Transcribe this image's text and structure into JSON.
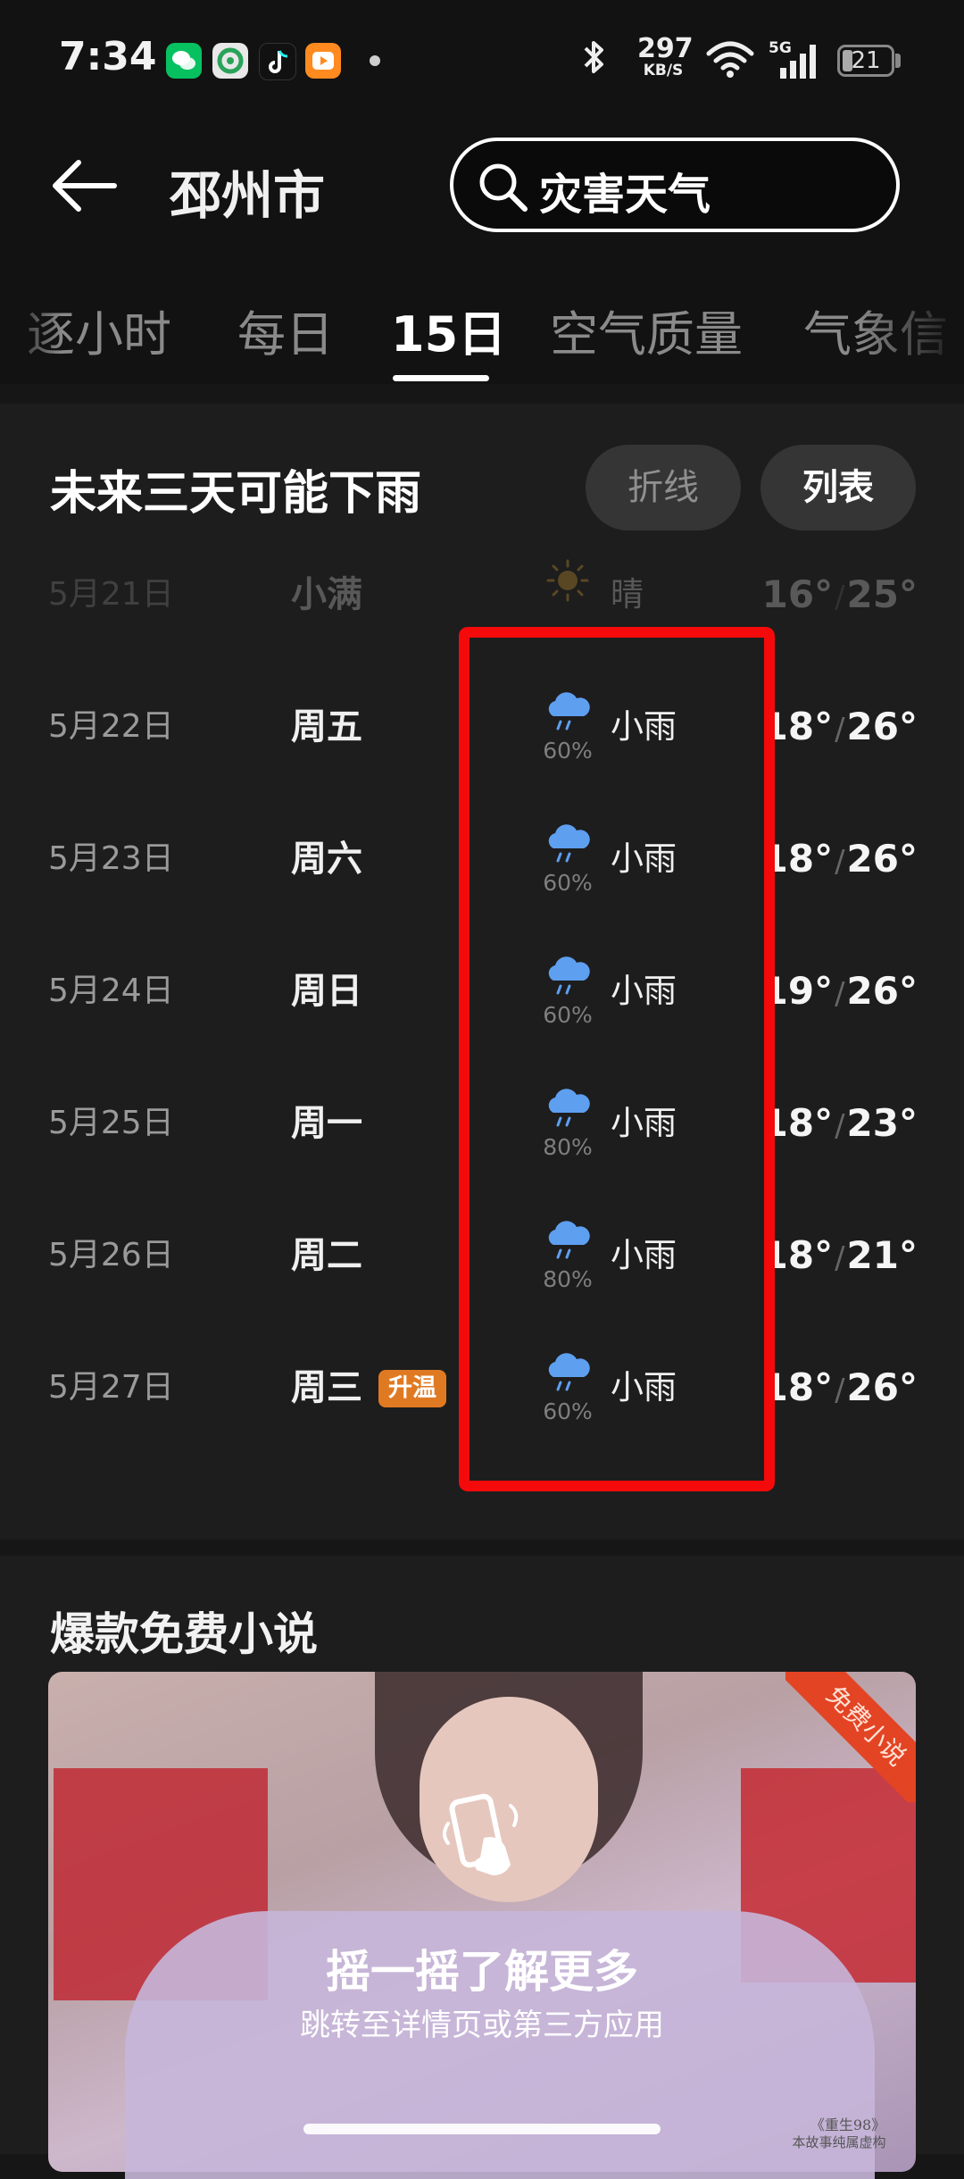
{
  "status_bar": {
    "time": "7:34",
    "network_speed": "297",
    "network_unit": "KB/S",
    "signal_label": "5G",
    "battery": "21",
    "app_icons": [
      "wechat-icon",
      "browser-icon",
      "tiktok-icon",
      "video-app-icon"
    ]
  },
  "header": {
    "city": "邳州市",
    "search_text": "灾害天气"
  },
  "tabs": [
    {
      "label": "逐小时",
      "active": false
    },
    {
      "label": "每日",
      "active": false
    },
    {
      "label": "15日",
      "active": true
    },
    {
      "label": "空气质量",
      "active": false
    },
    {
      "label": "气象信",
      "active": false
    }
  ],
  "forecast": {
    "title": "未来三天可能下雨",
    "view_line": "折线",
    "view_list": "列表",
    "rows": [
      {
        "date": "5月21日",
        "weekday": "小满",
        "condition": "晴",
        "pop": "",
        "low": "16°",
        "high": "25°",
        "icon": "sun-icon",
        "badge": ""
      },
      {
        "date": "5月22日",
        "weekday": "周五",
        "condition": "小雨",
        "pop": "60%",
        "low": "18°",
        "high": "26°",
        "icon": "light-rain-icon",
        "badge": ""
      },
      {
        "date": "5月23日",
        "weekday": "周六",
        "condition": "小雨",
        "pop": "60%",
        "low": "18°",
        "high": "26°",
        "icon": "light-rain-icon",
        "badge": ""
      },
      {
        "date": "5月24日",
        "weekday": "周日",
        "condition": "小雨",
        "pop": "60%",
        "low": "19°",
        "high": "26°",
        "icon": "light-rain-icon",
        "badge": ""
      },
      {
        "date": "5月25日",
        "weekday": "周一",
        "condition": "小雨",
        "pop": "80%",
        "low": "18°",
        "high": "23°",
        "icon": "light-rain-icon",
        "badge": ""
      },
      {
        "date": "5月26日",
        "weekday": "周二",
        "condition": "小雨",
        "pop": "80%",
        "low": "18°",
        "high": "21°",
        "icon": "light-rain-icon",
        "badge": ""
      },
      {
        "date": "5月27日",
        "weekday": "周三",
        "condition": "小雨",
        "pop": "60%",
        "low": "18°",
        "high": "26°",
        "icon": "light-rain-icon",
        "badge": "升温"
      }
    ]
  },
  "ad": {
    "section_title": "爆款免费小说",
    "corner_label": "免费小说",
    "main_text": "摇一摇了解更多",
    "sub_text": "跳转至详情页或第三方应用",
    "footnote_1": "《重生98》",
    "footnote_2": "本故事纯属虚构"
  },
  "colors": {
    "background": "#161616",
    "card": "#1d1d1d",
    "highlight_box": "#f40a0a",
    "rain_icon": "#5e9ff0",
    "badge": "#e07a22"
  }
}
